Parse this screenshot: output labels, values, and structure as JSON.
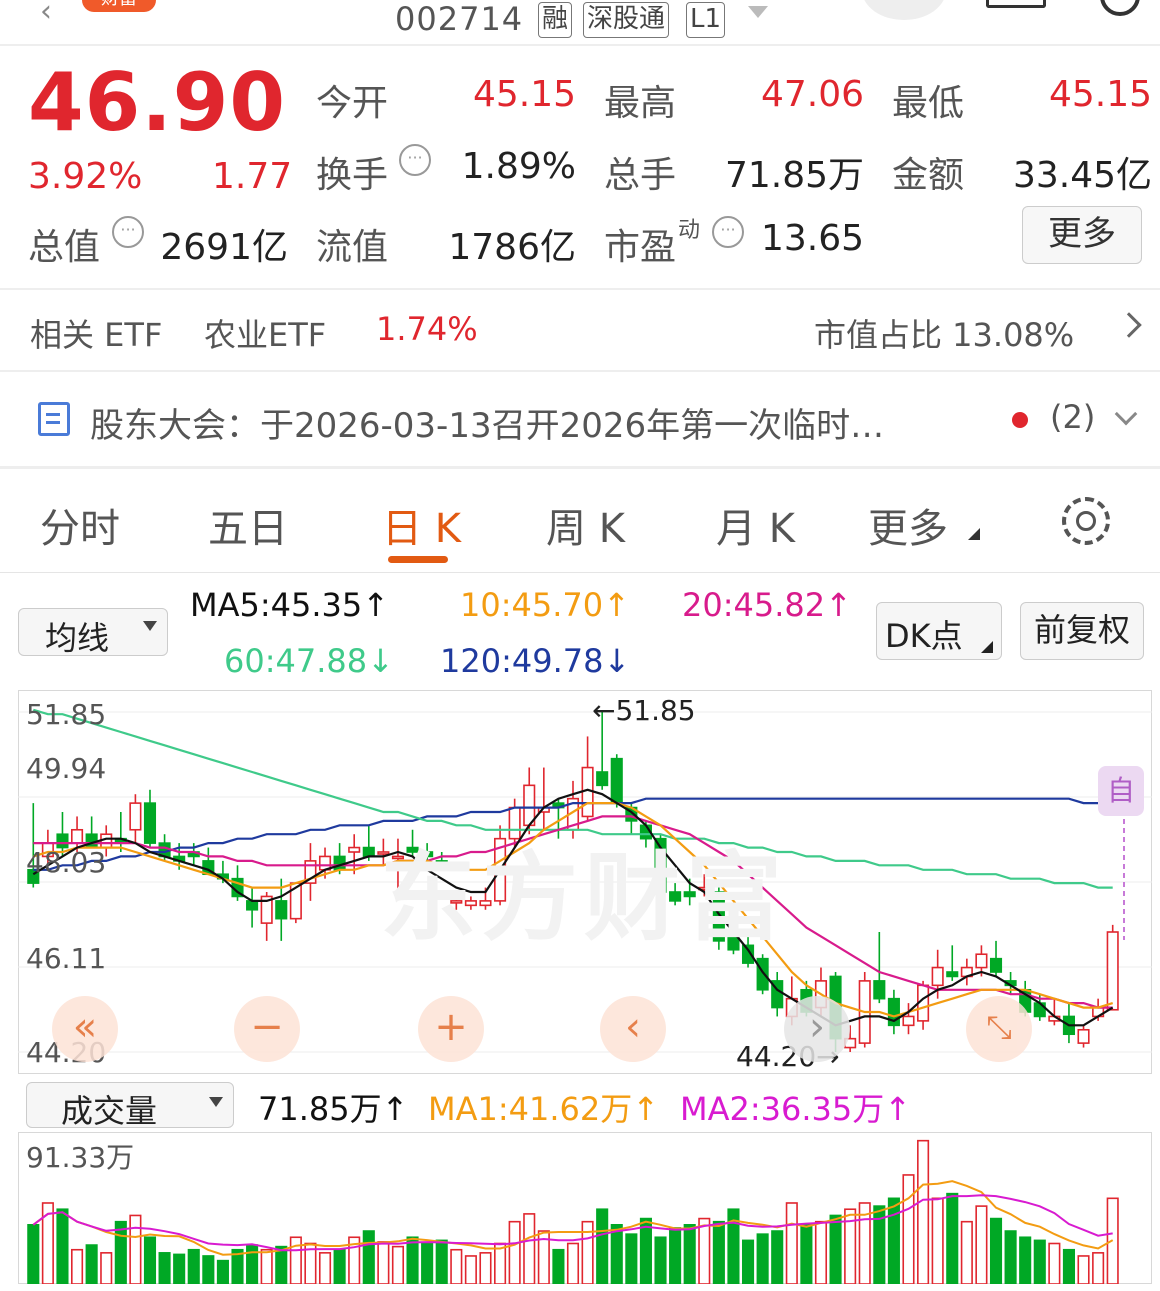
{
  "header": {
    "code": "002714",
    "tags": [
      "融",
      "深股通",
      "L1"
    ],
    "badge": "财富"
  },
  "quote": {
    "price": "46.90",
    "change_pct": "3.92%",
    "change": "1.77",
    "stats": [
      {
        "label": "今开",
        "value": "45.15"
      },
      {
        "label": "最高",
        "value": "47.06"
      },
      {
        "label": "最低",
        "value": "45.15"
      },
      {
        "label": "换手",
        "value": "1.89%"
      },
      {
        "label": "总手",
        "value": "71.85万"
      },
      {
        "label": "金额",
        "value": "33.45亿"
      },
      {
        "label": "总值",
        "value": "2691亿"
      },
      {
        "label": "流值",
        "value": "1786亿"
      },
      {
        "label": "市盈",
        "label_sup": "动",
        "value": "13.65"
      }
    ],
    "more_label": "更多"
  },
  "etf": {
    "label": "相关 ETF",
    "name": "农业ETF",
    "change": "1.74%",
    "share_label": "市值占比 13.08%"
  },
  "notice": {
    "text": "股东大会：于2026-03-13召开2026年第一次临时…",
    "count": "(2)"
  },
  "tabs": [
    "分时",
    "五日",
    "日 K",
    "周 K",
    "月 K",
    "更多"
  ],
  "active_tab": 2,
  "ma_panel": {
    "selector": "均线",
    "ma5": "MA5:45.35",
    "ma10": "10:45.70",
    "ma20": "20:45.82",
    "ma60": "60:47.88",
    "ma120": "120:49.78",
    "dk_label": "DK点",
    "adjust_label": "前复权",
    "arrow_up": "↑",
    "arrow_down": "↓"
  },
  "kline": {
    "y_labels": [
      "51.85",
      "49.94",
      "48.03",
      "46.11",
      "44.20"
    ],
    "high_mark": "←51.85",
    "low_mark": "44.20→",
    "watermark": "东方财富",
    "auto_label": "自",
    "colors": {
      "up": "#e0262e",
      "down": "#00a825",
      "ma5": "#111111",
      "ma10": "#f39c12",
      "ma20": "#d81b8c",
      "ma60": "#3fca8a",
      "ma120": "#1f3a9e"
    }
  },
  "chart_data": {
    "type": "candlestick",
    "title": "",
    "y_range": [
      44.2,
      51.85
    ],
    "candles": [
      {
        "o": 48.3,
        "h": 49.8,
        "l": 47.9,
        "c": 48.0
      },
      {
        "o": 48.6,
        "h": 49.2,
        "l": 48.4,
        "c": 48.9
      },
      {
        "o": 49.1,
        "h": 49.6,
        "l": 48.6,
        "c": 48.8
      },
      {
        "o": 48.9,
        "h": 49.5,
        "l": 48.7,
        "c": 49.2
      },
      {
        "o": 49.1,
        "h": 49.5,
        "l": 48.8,
        "c": 48.8
      },
      {
        "o": 48.8,
        "h": 49.3,
        "l": 48.6,
        "c": 49.1
      },
      {
        "o": 49.0,
        "h": 49.6,
        "l": 48.7,
        "c": 48.9
      },
      {
        "o": 49.2,
        "h": 50.0,
        "l": 48.9,
        "c": 49.8
      },
      {
        "o": 49.8,
        "h": 50.1,
        "l": 48.8,
        "c": 48.9
      },
      {
        "o": 48.9,
        "h": 49.1,
        "l": 48.5,
        "c": 48.6
      },
      {
        "o": 48.6,
        "h": 48.9,
        "l": 48.3,
        "c": 48.5
      },
      {
        "o": 48.7,
        "h": 48.9,
        "l": 48.4,
        "c": 48.6
      },
      {
        "o": 48.5,
        "h": 48.8,
        "l": 48.2,
        "c": 48.2
      },
      {
        "o": 48.2,
        "h": 48.5,
        "l": 48.0,
        "c": 48.1
      },
      {
        "o": 48.1,
        "h": 48.4,
        "l": 47.6,
        "c": 47.7
      },
      {
        "o": 47.6,
        "h": 47.9,
        "l": 47.0,
        "c": 47.4
      },
      {
        "o": 47.1,
        "h": 47.8,
        "l": 46.7,
        "c": 47.7
      },
      {
        "o": 47.6,
        "h": 48.1,
        "l": 46.7,
        "c": 47.2
      },
      {
        "o": 47.2,
        "h": 48.0,
        "l": 47.1,
        "c": 48.0
      },
      {
        "o": 48.0,
        "h": 48.9,
        "l": 47.6,
        "c": 48.5
      },
      {
        "o": 48.3,
        "h": 48.8,
        "l": 48.1,
        "c": 48.6
      },
      {
        "o": 48.6,
        "h": 48.9,
        "l": 48.2,
        "c": 48.3
      },
      {
        "o": 48.7,
        "h": 49.1,
        "l": 48.2,
        "c": 48.8
      },
      {
        "o": 48.8,
        "h": 49.3,
        "l": 48.5,
        "c": 48.6
      },
      {
        "o": 48.7,
        "h": 49.0,
        "l": 48.4,
        "c": 48.7
      },
      {
        "o": 48.6,
        "h": 49.0,
        "l": 47.8,
        "c": 48.6
      },
      {
        "o": 48.8,
        "h": 49.2,
        "l": 48.6,
        "c": 48.7
      },
      {
        "o": 48.7,
        "h": 48.9,
        "l": 48.4,
        "c": 48.6
      },
      {
        "o": 48.5,
        "h": 48.7,
        "l": 48.3,
        "c": 48.4
      },
      {
        "o": 47.6,
        "h": 47.8,
        "l": 47.4,
        "c": 47.6
      },
      {
        "o": 47.5,
        "h": 47.7,
        "l": 47.4,
        "c": 47.6
      },
      {
        "o": 47.5,
        "h": 47.9,
        "l": 47.4,
        "c": 47.6
      },
      {
        "o": 47.6,
        "h": 49.3,
        "l": 47.5,
        "c": 49.0
      },
      {
        "o": 49.0,
        "h": 49.9,
        "l": 48.8,
        "c": 49.7
      },
      {
        "o": 49.3,
        "h": 50.6,
        "l": 49.1,
        "c": 50.2
      },
      {
        "o": 49.6,
        "h": 50.6,
        "l": 49.2,
        "c": 49.7
      },
      {
        "o": 49.8,
        "h": 49.9,
        "l": 49.0,
        "c": 49.7
      },
      {
        "o": 49.2,
        "h": 50.3,
        "l": 49.0,
        "c": 49.9
      },
      {
        "o": 49.5,
        "h": 51.3,
        "l": 49.4,
        "c": 50.6
      },
      {
        "o": 50.5,
        "h": 51.85,
        "l": 50.1,
        "c": 50.2
      },
      {
        "o": 50.8,
        "h": 50.9,
        "l": 49.7,
        "c": 49.8
      },
      {
        "o": 49.7,
        "h": 49.8,
        "l": 49.1,
        "c": 49.4
      },
      {
        "o": 49.3,
        "h": 49.4,
        "l": 48.8,
        "c": 49.0
      },
      {
        "o": 49.0,
        "h": 49.1,
        "l": 47.7,
        "c": 47.8
      },
      {
        "o": 47.8,
        "h": 48.0,
        "l": 47.5,
        "c": 47.6
      },
      {
        "o": 47.8,
        "h": 48.1,
        "l": 47.5,
        "c": 47.7
      },
      {
        "o": 47.9,
        "h": 48.2,
        "l": 47.7,
        "c": 47.9
      },
      {
        "o": 47.8,
        "h": 47.9,
        "l": 46.5,
        "c": 46.7
      },
      {
        "o": 46.9,
        "h": 47.0,
        "l": 46.4,
        "c": 46.5
      },
      {
        "o": 46.6,
        "h": 46.8,
        "l": 46.1,
        "c": 46.2
      },
      {
        "o": 46.3,
        "h": 46.4,
        "l": 45.5,
        "c": 45.6
      },
      {
        "o": 45.8,
        "h": 46.0,
        "l": 45.0,
        "c": 45.2
      },
      {
        "o": 45.0,
        "h": 45.9,
        "l": 44.8,
        "c": 45.4
      },
      {
        "o": 45.6,
        "h": 45.8,
        "l": 45.0,
        "c": 45.1
      },
      {
        "o": 45.2,
        "h": 46.1,
        "l": 45.0,
        "c": 45.8
      },
      {
        "o": 45.9,
        "h": 46.0,
        "l": 44.2,
        "c": 44.5
      },
      {
        "o": 44.3,
        "h": 44.8,
        "l": 44.2,
        "c": 44.5
      },
      {
        "o": 44.4,
        "h": 46.0,
        "l": 44.3,
        "c": 45.8
      },
      {
        "o": 45.8,
        "h": 46.9,
        "l": 45.3,
        "c": 45.4
      },
      {
        "o": 45.4,
        "h": 45.6,
        "l": 44.6,
        "c": 44.8
      },
      {
        "o": 44.8,
        "h": 45.3,
        "l": 44.6,
        "c": 45.0
      },
      {
        "o": 44.9,
        "h": 45.8,
        "l": 44.7,
        "c": 45.7
      },
      {
        "o": 45.7,
        "h": 46.5,
        "l": 45.4,
        "c": 46.1
      },
      {
        "o": 46.0,
        "h": 46.6,
        "l": 45.8,
        "c": 45.9
      },
      {
        "o": 45.9,
        "h": 46.3,
        "l": 45.7,
        "c": 46.1
      },
      {
        "o": 46.1,
        "h": 46.6,
        "l": 45.9,
        "c": 46.4
      },
      {
        "o": 46.3,
        "h": 46.7,
        "l": 45.9,
        "c": 46.0
      },
      {
        "o": 45.8,
        "h": 46.0,
        "l": 45.5,
        "c": 45.7
      },
      {
        "o": 45.6,
        "h": 45.8,
        "l": 45.0,
        "c": 45.1
      },
      {
        "o": 45.3,
        "h": 45.5,
        "l": 44.9,
        "c": 45.0
      },
      {
        "o": 44.9,
        "h": 45.4,
        "l": 44.8,
        "c": 45.0
      },
      {
        "o": 45.0,
        "h": 45.3,
        "l": 44.4,
        "c": 44.6
      },
      {
        "o": 44.4,
        "h": 44.8,
        "l": 44.3,
        "c": 44.7
      },
      {
        "o": 45.0,
        "h": 45.4,
        "l": 44.9,
        "c": 45.2
      },
      {
        "o": 45.15,
        "h": 47.06,
        "l": 45.15,
        "c": 46.9
      }
    ],
    "ma": {
      "ma5": [
        48.2,
        48.4,
        48.6,
        48.8,
        48.9,
        49.0,
        49.0,
        48.9,
        48.7,
        48.6,
        48.5,
        48.4,
        48.3,
        48.1,
        47.8,
        47.6,
        47.6,
        47.7,
        47.9,
        48.1,
        48.3,
        48.4,
        48.5,
        48.6,
        48.6,
        48.7,
        48.6,
        48.3,
        48.1,
        47.9,
        47.8,
        47.8,
        48.3,
        48.8,
        49.3,
        49.7,
        49.9,
        50.0,
        50.1,
        50.0,
        49.8,
        49.6,
        49.3,
        48.8,
        48.4,
        48.0,
        47.8,
        47.3,
        46.9,
        46.5,
        46.0,
        45.6,
        45.4,
        45.2,
        45.0,
        44.8,
        44.9,
        45.0,
        45.0,
        44.9,
        45.1,
        45.4,
        45.6,
        45.7,
        45.9,
        46.0,
        45.9,
        45.7,
        45.5,
        45.3,
        45.0,
        44.8,
        44.8,
        45.0,
        45.2
      ],
      "ma10": [
        48.6,
        48.7,
        48.7,
        48.8,
        48.8,
        48.8,
        48.8,
        48.7,
        48.6,
        48.5,
        48.4,
        48.3,
        48.2,
        48.1,
        48.0,
        47.9,
        47.9,
        47.9,
        48.0,
        48.1,
        48.2,
        48.3,
        48.3,
        48.4,
        48.4,
        48.5,
        48.5,
        48.5,
        48.4,
        48.3,
        48.3,
        48.3,
        48.5,
        48.7,
        48.9,
        49.2,
        49.4,
        49.6,
        49.8,
        49.8,
        49.8,
        49.7,
        49.5,
        49.3,
        49.0,
        48.7,
        48.4,
        48.0,
        47.6,
        47.2,
        46.8,
        46.4,
        46.0,
        45.7,
        45.5,
        45.3,
        45.2,
        45.1,
        45.1,
        45.0,
        45.1,
        45.2,
        45.3,
        45.4,
        45.5,
        45.6,
        45.6,
        45.6,
        45.6,
        45.5,
        45.4,
        45.3,
        45.2,
        45.2,
        45.3
      ],
      "ma20": [
        48.9,
        48.9,
        48.9,
        48.9,
        48.9,
        48.9,
        48.9,
        48.9,
        48.8,
        48.8,
        48.7,
        48.7,
        48.6,
        48.6,
        48.5,
        48.5,
        48.4,
        48.4,
        48.4,
        48.4,
        48.4,
        48.4,
        48.4,
        48.4,
        48.4,
        48.5,
        48.5,
        48.5,
        48.6,
        48.6,
        48.7,
        48.7,
        48.8,
        48.9,
        49.0,
        49.1,
        49.2,
        49.3,
        49.4,
        49.5,
        49.5,
        49.5,
        49.4,
        49.3,
        49.2,
        49.1,
        48.9,
        48.7,
        48.5,
        48.2,
        47.9,
        47.6,
        47.3,
        47.0,
        46.8,
        46.6,
        46.4,
        46.2,
        46.0,
        45.9,
        45.8,
        45.7,
        45.6,
        45.6,
        45.6,
        45.6,
        45.6,
        45.5,
        45.5,
        45.4,
        45.4,
        45.3,
        45.3,
        45.2,
        45.2
      ],
      "ma60": [
        51.9,
        51.8,
        51.8,
        51.7,
        51.6,
        51.5,
        51.4,
        51.3,
        51.2,
        51.1,
        51.0,
        50.9,
        50.8,
        50.7,
        50.6,
        50.5,
        50.4,
        50.3,
        50.2,
        50.1,
        50.0,
        49.9,
        49.8,
        49.7,
        49.6,
        49.6,
        49.5,
        49.4,
        49.4,
        49.3,
        49.3,
        49.2,
        49.2,
        49.2,
        49.2,
        49.2,
        49.2,
        49.2,
        49.2,
        49.1,
        49.1,
        49.1,
        49.1,
        49.1,
        49.0,
        49.0,
        49.0,
        48.9,
        48.9,
        48.8,
        48.8,
        48.7,
        48.7,
        48.6,
        48.6,
        48.5,
        48.5,
        48.5,
        48.4,
        48.4,
        48.4,
        48.3,
        48.3,
        48.3,
        48.2,
        48.2,
        48.2,
        48.1,
        48.1,
        48.1,
        48.0,
        48.0,
        48.0,
        47.9,
        47.9
      ],
      "ma120": [
        48.3,
        48.3,
        48.4,
        48.4,
        48.5,
        48.5,
        48.6,
        48.6,
        48.7,
        48.7,
        48.8,
        48.8,
        48.9,
        48.9,
        49.0,
        49.0,
        49.1,
        49.1,
        49.1,
        49.2,
        49.2,
        49.3,
        49.3,
        49.3,
        49.4,
        49.4,
        49.4,
        49.5,
        49.5,
        49.5,
        49.6,
        49.6,
        49.6,
        49.7,
        49.7,
        49.7,
        49.7,
        49.8,
        49.8,
        49.8,
        49.8,
        49.8,
        49.9,
        49.9,
        49.9,
        49.9,
        49.9,
        49.9,
        49.9,
        49.9,
        49.9,
        49.9,
        49.9,
        49.9,
        49.9,
        49.9,
        49.9,
        49.9,
        49.9,
        49.9,
        49.9,
        49.9,
        49.9,
        49.9,
        49.9,
        49.9,
        49.9,
        49.9,
        49.9,
        49.9,
        49.9,
        49.9,
        49.8,
        49.8,
        49.8
      ]
    },
    "volume": {
      "max_label": "91.33万",
      "values": [
        38,
        52,
        48,
        22,
        25,
        20,
        40,
        44,
        30,
        20,
        19,
        22,
        18,
        15,
        22,
        25,
        22,
        24,
        30,
        26,
        20,
        22,
        30,
        34,
        27,
        24,
        30,
        26,
        28,
        22,
        18,
        20,
        26,
        40,
        45,
        34,
        22,
        26,
        40,
        48,
        38,
        32,
        42,
        30,
        36,
        38,
        42,
        40,
        48,
        28,
        32,
        34,
        52,
        38,
        40,
        44,
        48,
        52,
        50,
        55,
        70,
        92,
        55,
        58,
        40,
        50,
        42,
        34,
        30,
        28,
        26,
        22,
        18,
        20,
        55
      ]
    }
  },
  "volume_panel": {
    "selector": "成交量",
    "vol": "71.85万",
    "ma1": "MA1:41.62万",
    "ma2": "MA2:36.35万"
  }
}
